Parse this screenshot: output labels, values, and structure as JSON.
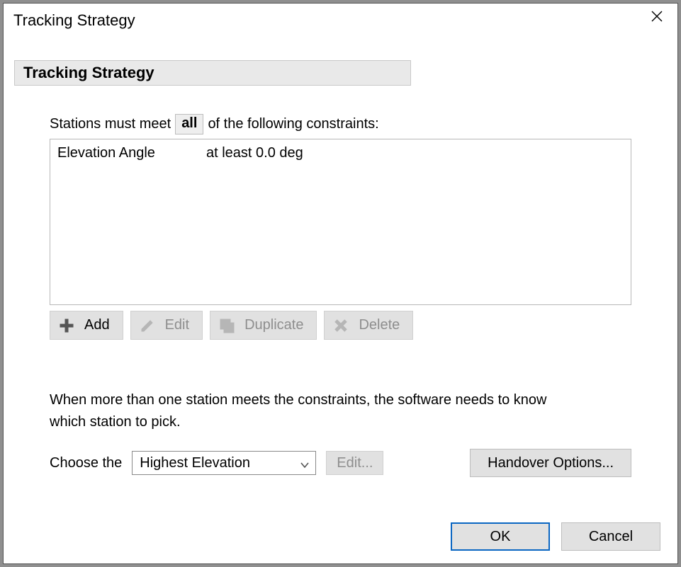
{
  "window": {
    "title": "Tracking Strategy"
  },
  "section_header": "Tracking Strategy",
  "constraint_sentence": {
    "prefix": "Stations must meet",
    "mode": "all",
    "suffix": "of the following constraints:"
  },
  "constraints": [
    {
      "name": "Elevation Angle",
      "condition": "at least 0.0 deg"
    }
  ],
  "toolbar": {
    "add": "Add",
    "edit": "Edit",
    "duplicate": "Duplicate",
    "delete": "Delete"
  },
  "explanation": "When more than one station meets the constraints, the software needs to know which station to pick.",
  "choose": {
    "label": "Choose the",
    "selected": "Highest Elevation",
    "edit": "Edit...",
    "handover": "Handover Options..."
  },
  "dialog": {
    "ok": "OK",
    "cancel": "Cancel"
  }
}
